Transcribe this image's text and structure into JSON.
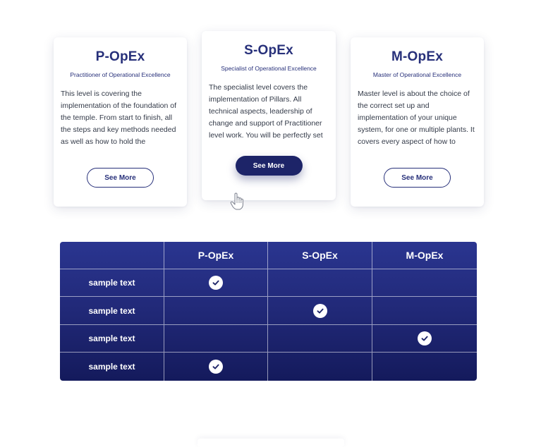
{
  "cards": [
    {
      "title": "P-OpEx",
      "subtitle": "Practitioner of Operational Excellence",
      "body": "This level is covering the implementation of the foundation of the temple. From start to finish, all the steps and key methods needed as well as how to hold the",
      "button": "See More",
      "state": "default"
    },
    {
      "title": "S-OpEx",
      "subtitle": "Specialist of Operational Excellence",
      "body": "The specialist level covers the implementation of Pillars. All technical aspects, leadership of change and support of Practitioner level work. You will be perfectly set",
      "button": "See More",
      "state": "hover"
    },
    {
      "title": "M-OpEx",
      "subtitle": "Master of Operational Excellence",
      "body": "Master level is about the choice of the correct set up and implementation of your unique system, for one or multiple plants. It covers every aspect of how to",
      "button": "See More",
      "state": "default"
    }
  ],
  "table": {
    "headers": [
      "",
      "P-OpEx",
      "S-OpEx",
      "M-OpEx"
    ],
    "rows": [
      {
        "label": "sample text",
        "checks": [
          true,
          false,
          false
        ]
      },
      {
        "label": "sample text",
        "checks": [
          false,
          true,
          false
        ]
      },
      {
        "label": "sample text",
        "checks": [
          false,
          false,
          true
        ]
      },
      {
        "label": "sample text",
        "checks": [
          true,
          false,
          false
        ]
      }
    ]
  },
  "colors": {
    "brand": "#27307a",
    "button_filled": "#1d2468",
    "table_top": "#2a3590",
    "table_bottom": "#141a5c"
  },
  "icons": {
    "cursor": "hand-pointer-icon",
    "check": "check-circle-icon"
  }
}
